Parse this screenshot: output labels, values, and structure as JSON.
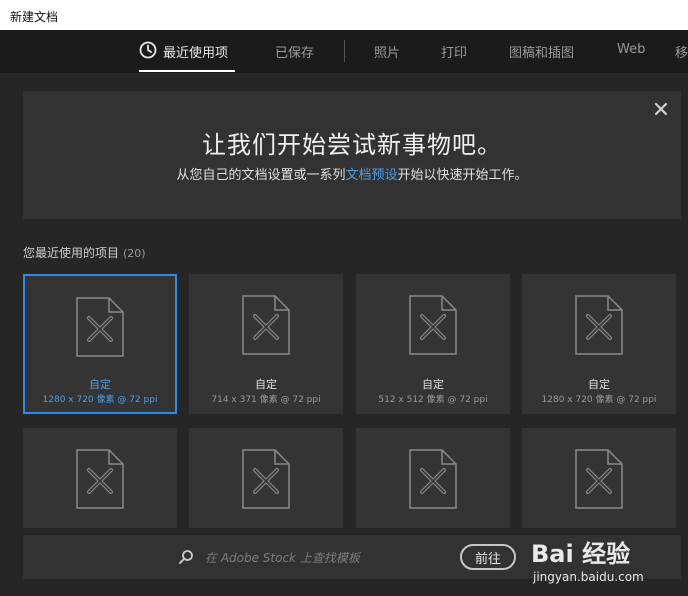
{
  "window": {
    "title": "新建文档"
  },
  "tabs": [
    {
      "label": "最近使用项",
      "active": true
    },
    {
      "label": "已保存"
    },
    {
      "label": "照片"
    },
    {
      "label": "打印"
    },
    {
      "label": "图稿和插图"
    },
    {
      "label": "Web"
    },
    {
      "label": "移"
    }
  ],
  "hero": {
    "title": "让我们开始尝试新事物吧。",
    "subtitle_before": "从您自己的文档设置或一系列",
    "subtitle_link": "文档预设",
    "subtitle_after": "开始以快速开始工作。"
  },
  "recent": {
    "heading": "您最近使用的项目",
    "count": "(20)"
  },
  "cards": [
    {
      "name": "自定",
      "meta": "1280 x 720 像素 @ 72 ppi",
      "selected": true
    },
    {
      "name": "自定",
      "meta": "714 x 371 像素 @ 72 ppi"
    },
    {
      "name": "自定",
      "meta": "512 x 512 像素 @ 72 ppi"
    },
    {
      "name": "自定",
      "meta": "1280 x 720 像素 @ 72 ppi"
    },
    {
      "name": "",
      "meta": ""
    },
    {
      "name": "",
      "meta": ""
    },
    {
      "name": "",
      "meta": ""
    },
    {
      "name": "",
      "meta": ""
    }
  ],
  "stock": {
    "placeholder": "在 Adobe Stock 上查找模板",
    "button_label": "前往"
  },
  "watermark": {
    "logo": "Bai 经验",
    "url": "jingyan.baidu.com"
  },
  "colors": {
    "accent": "#2d8ceb",
    "panel": "#323232",
    "background": "#262626"
  }
}
